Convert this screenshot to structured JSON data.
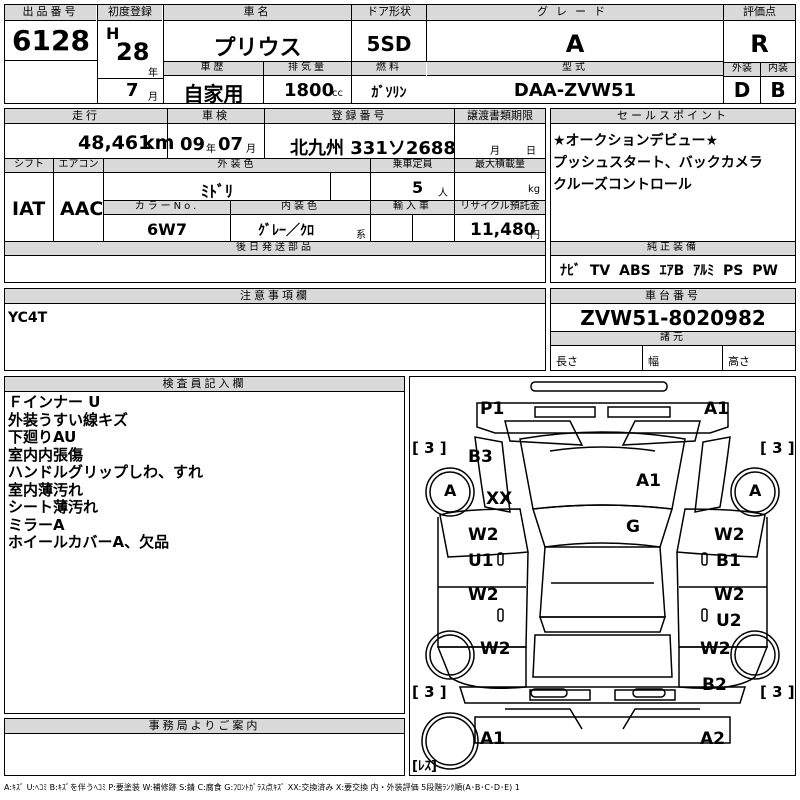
{
  "headers": {
    "lot_no": "出品番号",
    "first_reg": "初度登録",
    "car_name": "車名",
    "door": "ドア形状",
    "grade": "グレード",
    "score": "評価点",
    "history": "車歴",
    "displacement": "排気量",
    "fuel": "燃料",
    "model": "型式",
    "exterior": "外装",
    "interior": "内装",
    "mileage": "走行",
    "inspection": "車検",
    "reg_no": "登録番号",
    "transfer_deadline": "譲渡書類期限",
    "sales_point": "セールスポイント",
    "shift": "シフト",
    "aircon": "エアコン",
    "ext_color": "外装色",
    "capacity": "乗車定員",
    "max_load": "最大積載量",
    "color_no": "カラーNo.",
    "int_color": "内装色",
    "import": "輸入車",
    "recycle": "リサイクル預託金",
    "later_parts": "後日発送部品",
    "genuine_equip": "純正装備",
    "notes": "注意事項欄",
    "chassis_no": "車台番号",
    "dimensions": "諸元",
    "inspector": "検査員記入欄",
    "office": "事務局よりご案内"
  },
  "lot_no": "6128",
  "era": "H",
  "reg_year": "28",
  "reg_year_unit": "年",
  "reg_month": "7",
  "reg_month_unit": "月",
  "car_name": "プリウス",
  "door": "5SD",
  "grade": "A",
  "score": "R",
  "history": "自家用",
  "displacement": "1800",
  "displacement_unit": "cc",
  "fuel": "ｶﾞｿﾘﾝ",
  "model": "DAA-ZVW51",
  "exterior_score": "D",
  "interior_score": "B",
  "mileage": "48,461",
  "mileage_unit": "km",
  "inspection_year": "09",
  "inspection_year_unit": "年",
  "inspection_month": "07",
  "inspection_month_unit": "月",
  "reg_no": "北九州 331ソ2688",
  "transfer_month_unit": "月",
  "transfer_day_unit": "日",
  "sales_points": [
    "★オークションデビュー★",
    "プッシュスタート、バックカメラ",
    "クルーズコントロール"
  ],
  "shift": "IAT",
  "aircon": "AAC",
  "ext_color": "ﾐﾄﾞﾘ",
  "capacity": "5",
  "capacity_unit": "人",
  "max_load_unit": "kg",
  "color_no": "6W7",
  "int_color": "ｸﾞﾚｰ／ｸﾛ",
  "int_color_suffix": "系",
  "recycle": "11,480",
  "recycle_unit": "円",
  "equipment": [
    "ﾅﾋﾞ",
    "TV",
    "ABS",
    "ｴｱB",
    "ｱﾙﾐ",
    "PS",
    "PW"
  ],
  "notes": "YC4T",
  "chassis_no": "ZVW51-8020982",
  "dim_labels": {
    "length": "長さ",
    "width": "幅",
    "height": "高さ"
  },
  "inspector_notes": [
    "Ｆインナー U",
    "外装うすい線キズ",
    "下廻りAU",
    "室内内張傷",
    "ハンドルグリップしわ、すれ",
    "室内薄汚れ",
    "シート薄汚れ",
    "ミラーA",
    "ホイールカバーA、欠品"
  ],
  "diagram": {
    "p1": "P1",
    "a1_front": "A1",
    "b3": "B3",
    "xx": "XX",
    "a1_hood": "A1",
    "g": "G",
    "w2_left_front_door": "W2",
    "u1": "U1",
    "w2_right_front_door": "W2",
    "b1": "B1",
    "w2_left_rear_door": "W2",
    "w2_right_rear_door": "W2",
    "u2": "U2",
    "w2_left_rear": "W2",
    "w2_right_rear": "W2",
    "b2": "B2",
    "a1_rear_left": "A1",
    "a2_rear_right": "A2",
    "tire_front_left": "A",
    "tire_front_right": "A",
    "tire_front_left_tread": "3",
    "tire_front_right_tread": "3",
    "tire_rear_left_tread": "3",
    "tire_rear_right_tread": "3",
    "spare": "ﾚｽ"
  },
  "legend": "A:ｷｽﾞ U:ﾍｺﾐ B:ｷｽﾞを伴うﾍｺﾐ P:要塗装 W:補修跡 S:錆 C:腐食 G:ﾌﾛﾝﾄｶﾞﾗｽ点ｷｽﾞ XX:交換済み X:要交換 内・外装評価 5段階ﾗﾝｸ順(A･B･C･D･E) 1"
}
